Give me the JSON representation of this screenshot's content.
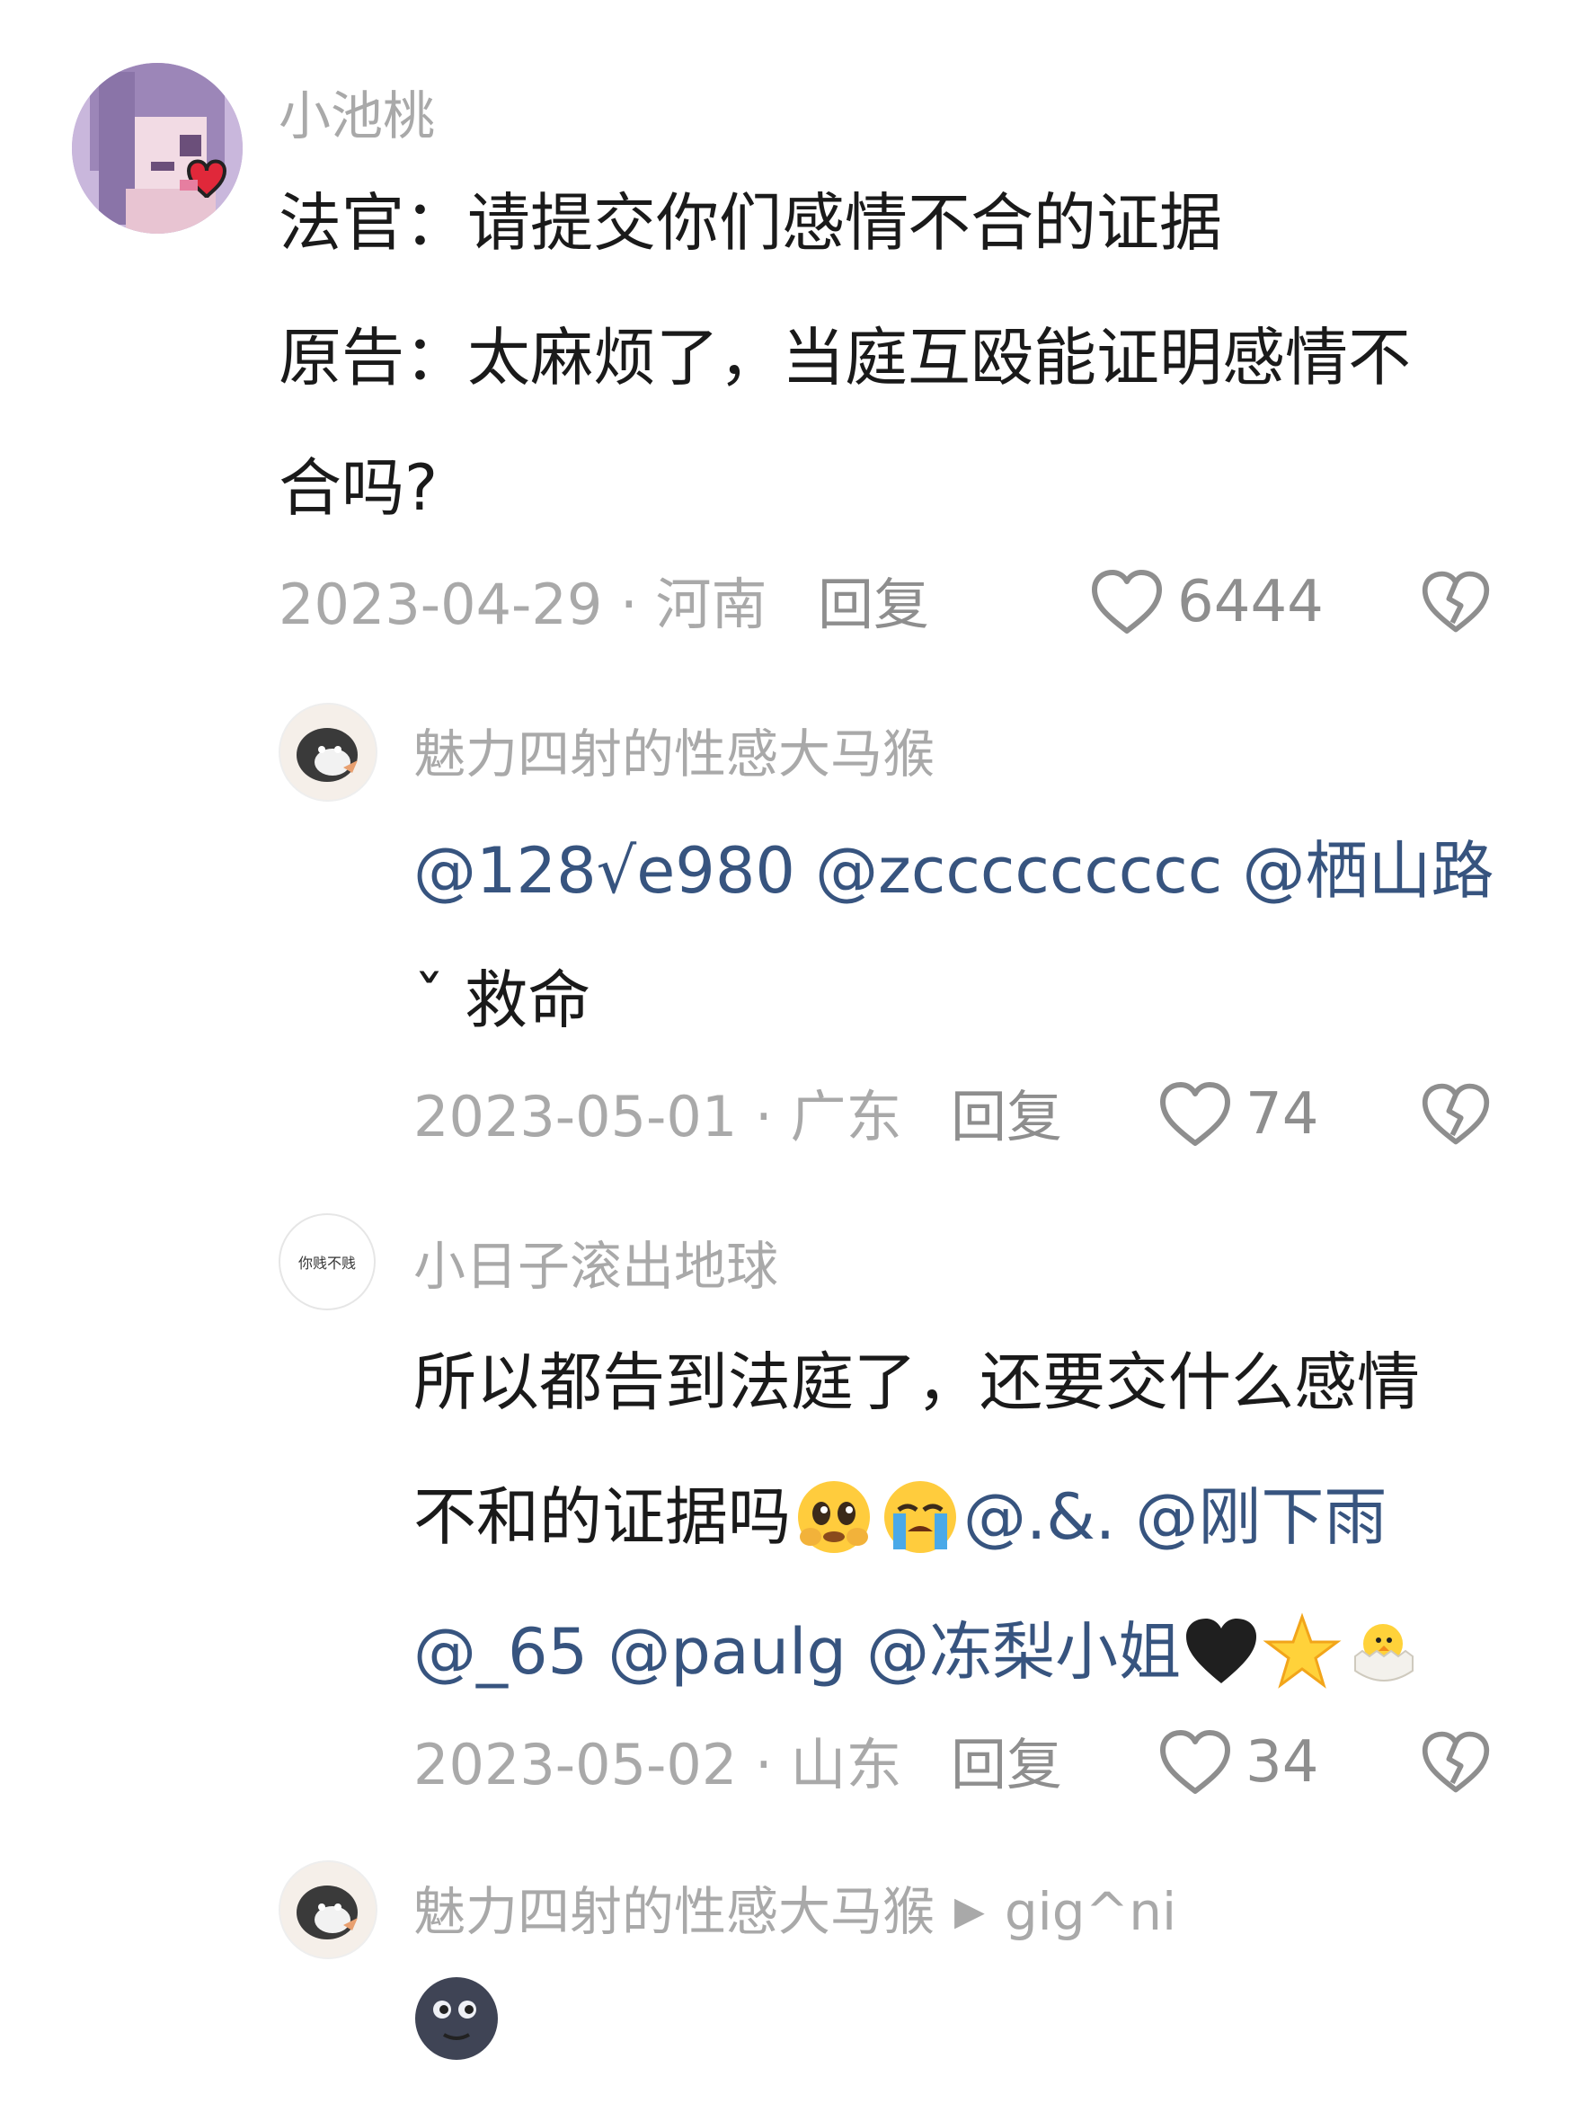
{
  "comments": [
    {
      "user": "小池桃",
      "lines": [
        "法官：请提交你们感情不合的证据",
        "原告：太麻烦了，当庭互殴能证明感情不",
        "合吗?"
      ],
      "date": "2023-04-29 · 河南",
      "reply_label": "回复",
      "likes": "6444"
    },
    {
      "user": "魅力四射的性感大马猴",
      "mentions_line": "@128√e980 @zccccccccc @栖山路",
      "line2": "ˇ 救命",
      "date": "2023-05-01 · 广东",
      "reply_label": "回复",
      "likes": "74"
    },
    {
      "user": "小日子滚出地球",
      "avatar_text": "你贱不贱",
      "line1": "所以都告到法庭了，还要交什么感情",
      "line2_text": "不和的证据吗",
      "line2_mentions": "@.&. @刚下雨",
      "line3_mentions": "@_65 @paulg @冻梨小姐",
      "date": "2023-05-02 · 山东",
      "reply_label": "回复",
      "likes": "34"
    },
    {
      "user": "魅力四射的性感大马猴",
      "reply_to": "gig^ni"
    }
  ],
  "emojis": [
    "pleading-face",
    "loudly-crying-face",
    "black-heart",
    "glowing-star",
    "hatching-chick",
    "new-moon-face"
  ],
  "colors": {
    "mention": "#37547f",
    "meta": "#a9a9a9",
    "text": "#1a1a1a"
  }
}
